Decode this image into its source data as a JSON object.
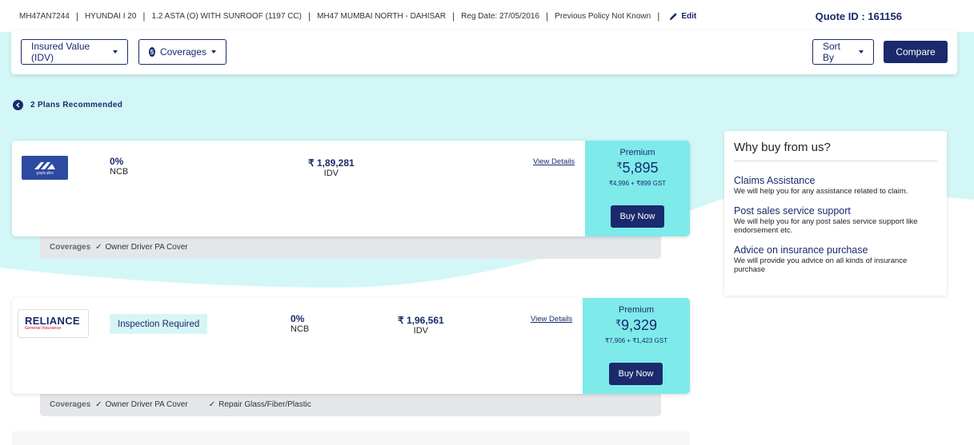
{
  "topbar": {
    "reg_no": "MH47AN7244",
    "model": "HYUNDAI I 20",
    "variant": "1.2 ASTA (O) WITH SUNROOF (1197 CC)",
    "rto": "MH47 MUMBAI NORTH - DAHISAR",
    "reg_date": "Reg Date: 27/05/2016",
    "policy": "Previous Policy Not Known",
    "edit_label": "Edit",
    "quote_id": "Quote ID : 161156"
  },
  "filters": {
    "idv_label": "Insured Value (IDV)",
    "coverages_count": "5",
    "coverages_label": "Coverages",
    "sort_label": "Sort By",
    "compare_label": "Compare"
  },
  "plans_recommended": "2 Plans Recommended",
  "plans": [
    {
      "insurer": "United India Insurance",
      "logo_text": "युनाइटेड इंडिया",
      "ncb_value": "0%",
      "ncb_label": "NCB",
      "idv_value": "₹ 1,89,281",
      "idv_label": "IDV",
      "view_details": "View Details",
      "premium_label": "Premium",
      "premium_symbol": "₹",
      "premium_amount": "5,895",
      "premium_breakup": "₹4,996 + ₹899 GST",
      "buy_label": "Buy Now",
      "coverages_label": "Coverages",
      "coverages": [
        "Owner Driver PA Cover"
      ]
    },
    {
      "insurer": "Reliance General Insurance",
      "logo_text": "RELIANCE",
      "logo_sub": "General Insurance",
      "tag": "Inspection Required",
      "ncb_value": "0%",
      "ncb_label": "NCB",
      "idv_value": "₹ 1,96,561",
      "idv_label": "IDV",
      "view_details": "View Details",
      "premium_label": "Premium",
      "premium_symbol": "₹",
      "premium_amount": "9,329",
      "premium_breakup": "₹7,906 + ₹1,423 GST",
      "buy_label": "Buy Now",
      "coverages_label": "Coverages",
      "coverages": [
        "Owner Driver PA Cover",
        "Repair Glass/Fiber/Plastic"
      ]
    }
  ],
  "why": {
    "title": "Why buy from us?",
    "items": [
      {
        "title": "Claims Assistance",
        "desc": "We will help you for any assistance related to claim."
      },
      {
        "title": "Post sales service support",
        "desc": "We will help you for any post sales service support like endorsement etc."
      },
      {
        "title": "Advice on insurance purchase",
        "desc": "We will provide you advice on all kinds of insurance purchase"
      }
    ]
  },
  "colors": {
    "brand_navy": "#1a2a6c",
    "premium_bg": "#7eeaea",
    "wave": "#d3f7f7",
    "coverage_strip": "#e4e6ea",
    "united_logo_bg": "#2c4aa0",
    "reliance_red": "#c8102e"
  }
}
